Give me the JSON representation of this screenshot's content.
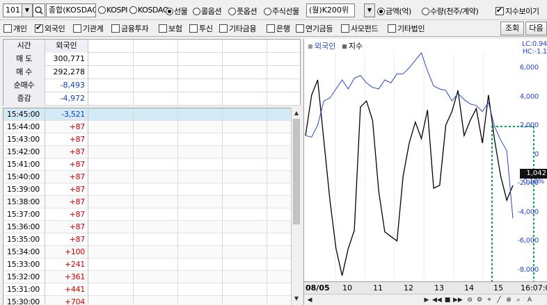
{
  "toolbar": {
    "code": "101",
    "combo_market": "종합(KOSDAQ",
    "radios": [
      {
        "label": "KOSPI",
        "selected": false
      },
      {
        "label": "KOSDAQ",
        "selected": false
      },
      {
        "label": "선물",
        "selected": true
      },
      {
        "label": "콜옵션",
        "selected": false
      },
      {
        "label": "풋옵션",
        "selected": false
      },
      {
        "label": "주식선물",
        "selected": false
      }
    ],
    "combo_product": "(월)K200위",
    "radios_unit": [
      {
        "label": "금액(억)",
        "selected": true
      },
      {
        "label": "수량(천주/계약)",
        "selected": false
      }
    ],
    "show_index_label": "지수보이기",
    "show_index_checked": true
  },
  "investors": [
    {
      "label": "개인",
      "checked": false
    },
    {
      "label": "외국인",
      "checked": true
    },
    {
      "label": "기관계",
      "checked": false
    },
    {
      "label": "금융투자",
      "checked": false
    },
    {
      "label": "보험",
      "checked": false
    },
    {
      "label": "투신",
      "checked": false
    },
    {
      "label": "기타금융",
      "checked": false
    },
    {
      "label": "은행",
      "checked": false
    },
    {
      "label": "연기금등",
      "checked": false
    },
    {
      "label": "사모펀드",
      "checked": false
    },
    {
      "label": "기타법인",
      "checked": false
    }
  ],
  "buttons": {
    "query": "조회",
    "next": "다음"
  },
  "summary": {
    "header": {
      "label": "시간",
      "col": "외국인"
    },
    "rows": [
      {
        "label": "매 도",
        "value": "300,771",
        "tone": "plain"
      },
      {
        "label": "매 수",
        "value": "292,278",
        "tone": "plain"
      },
      {
        "label": "순매수",
        "value": "-8,493",
        "tone": "neg"
      },
      {
        "label": "증감",
        "value": "-4,972",
        "tone": "neg"
      }
    ]
  },
  "timeline": [
    {
      "time": "15:45:00",
      "value": "-3,521",
      "tone": "neg"
    },
    {
      "time": "15:44:00",
      "value": "+87",
      "tone": "pos"
    },
    {
      "time": "15:43:00",
      "value": "+87",
      "tone": "pos"
    },
    {
      "time": "15:42:00",
      "value": "+87",
      "tone": "pos"
    },
    {
      "time": "15:41:00",
      "value": "+87",
      "tone": "pos"
    },
    {
      "time": "15:40:00",
      "value": "+87",
      "tone": "pos"
    },
    {
      "time": "15:39:00",
      "value": "+87",
      "tone": "pos"
    },
    {
      "time": "15:38:00",
      "value": "+87",
      "tone": "pos"
    },
    {
      "time": "15:37:00",
      "value": "+87",
      "tone": "pos"
    },
    {
      "time": "15:36:00",
      "value": "+87",
      "tone": "pos"
    },
    {
      "time": "15:35:00",
      "value": "+87",
      "tone": "pos"
    },
    {
      "time": "15:34:00",
      "value": "+100",
      "tone": "pos"
    },
    {
      "time": "15:33:00",
      "value": "+241",
      "tone": "pos"
    },
    {
      "time": "15:32:00",
      "value": "+361",
      "tone": "pos"
    },
    {
      "time": "15:31:00",
      "value": "+441",
      "tone": "pos"
    },
    {
      "time": "15:30:00",
      "value": "+704",
      "tone": "pos"
    }
  ],
  "chart": {
    "legend": [
      {
        "label": "외국인"
      },
      {
        "label": "지수"
      }
    ],
    "lc_label": "LC:0.94",
    "hc_label": "HC:-1.1",
    "current_value": "1,042",
    "pct_label": "0.10%",
    "y_ticks": [
      "6,000",
      "4,000",
      "2,000",
      "0",
      "-2,000",
      "-4,000",
      "-6,000",
      "-8,000"
    ],
    "x_labels": [
      "08/05",
      "10",
      "11",
      "12",
      "13",
      "14",
      "15"
    ],
    "time_label": "16:07:0",
    "colors": {
      "foreign": "#000000",
      "index": "#2a46c8",
      "highlight": "#00a040",
      "axis_text": "#2a46c8"
    }
  },
  "chart_data": {
    "type": "line",
    "title": "",
    "xlabel": "",
    "ylabel": "",
    "ylim": [
      -8000,
      7000
    ],
    "x_categories": [
      "08/05",
      "10",
      "11",
      "12",
      "13",
      "14",
      "15"
    ],
    "series": [
      {
        "name": "외국인",
        "values": [
          1500,
          4200,
          5200,
          1200,
          -2800,
          -6000,
          -7800,
          -6000,
          -4800,
          3400,
          3800,
          2500,
          -2200,
          -4900,
          -5200,
          -5500,
          -1200,
          1000,
          2400,
          1300,
          3200,
          -2000,
          -1800,
          2200,
          3100,
          4500,
          1500,
          2500,
          3300,
          1000,
          4200,
          1200,
          -1200,
          -2800,
          -1800
        ]
      },
      {
        "name": "지수",
        "values": [
          1500,
          1400,
          2200,
          3800,
          4000,
          4600,
          5200,
          4600,
          5300,
          5500,
          5000,
          4700,
          4600,
          5200,
          5000,
          5600,
          5600,
          6000,
          6500,
          7000,
          5800,
          4800,
          4600,
          4500,
          3800,
          4300,
          3900,
          3600,
          3500,
          3100,
          3700,
          2100,
          1200,
          500,
          -4000
        ]
      }
    ]
  }
}
